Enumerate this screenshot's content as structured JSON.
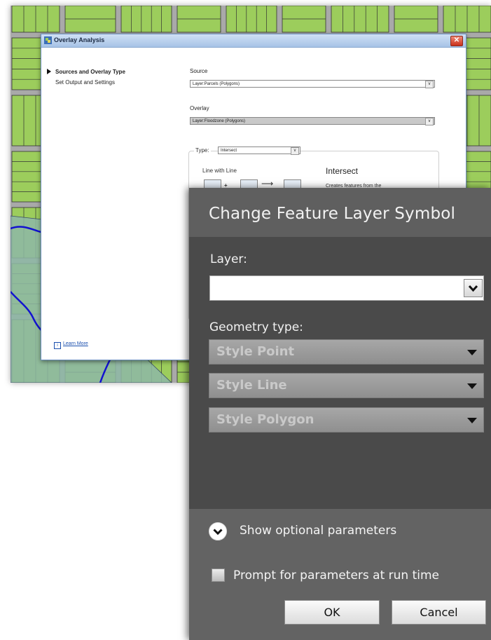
{
  "overlay_window": {
    "title": "Overlay Analysis",
    "close_glyph": "✕",
    "nav": [
      {
        "label": "Sources and Overlay Type",
        "active": true
      },
      {
        "label": "Set Output and Settings",
        "active": false
      }
    ],
    "source_label": "Source",
    "source_value": "Layer:Parcels (Polygons)",
    "overlay_label": "Overlay",
    "overlay_value": "Layer:Floodzone (Polygons)",
    "type_label": "Type:",
    "type_value": "Intersect",
    "line_with_line": "Line with Line",
    "intersect_heading": "Intersect",
    "intersect_desc": "Creates features from the",
    "learn_more": "Learn More",
    "dropdown_glyph": "v"
  },
  "feature_panel": {
    "title": "Change Feature Layer Symbol",
    "layer_label": "Layer:",
    "layer_value": "",
    "geometry_label": "Geometry type:",
    "style_options": [
      "Style Point",
      "Style Line",
      "Style Polygon"
    ],
    "optional_params": "Show optional parameters",
    "prompt_label": "Prompt for parameters at run time",
    "prompt_checked": false,
    "ok": "OK",
    "cancel": "Cancel"
  },
  "colors": {
    "parcel_green": "#9ccd5c",
    "street_gray": "#a9a9a9",
    "floodzone": "#8fb9a6",
    "river_blue": "#1212d0",
    "panel_dark": "#4a4a4a",
    "panel_header": "#5f5f5f"
  }
}
